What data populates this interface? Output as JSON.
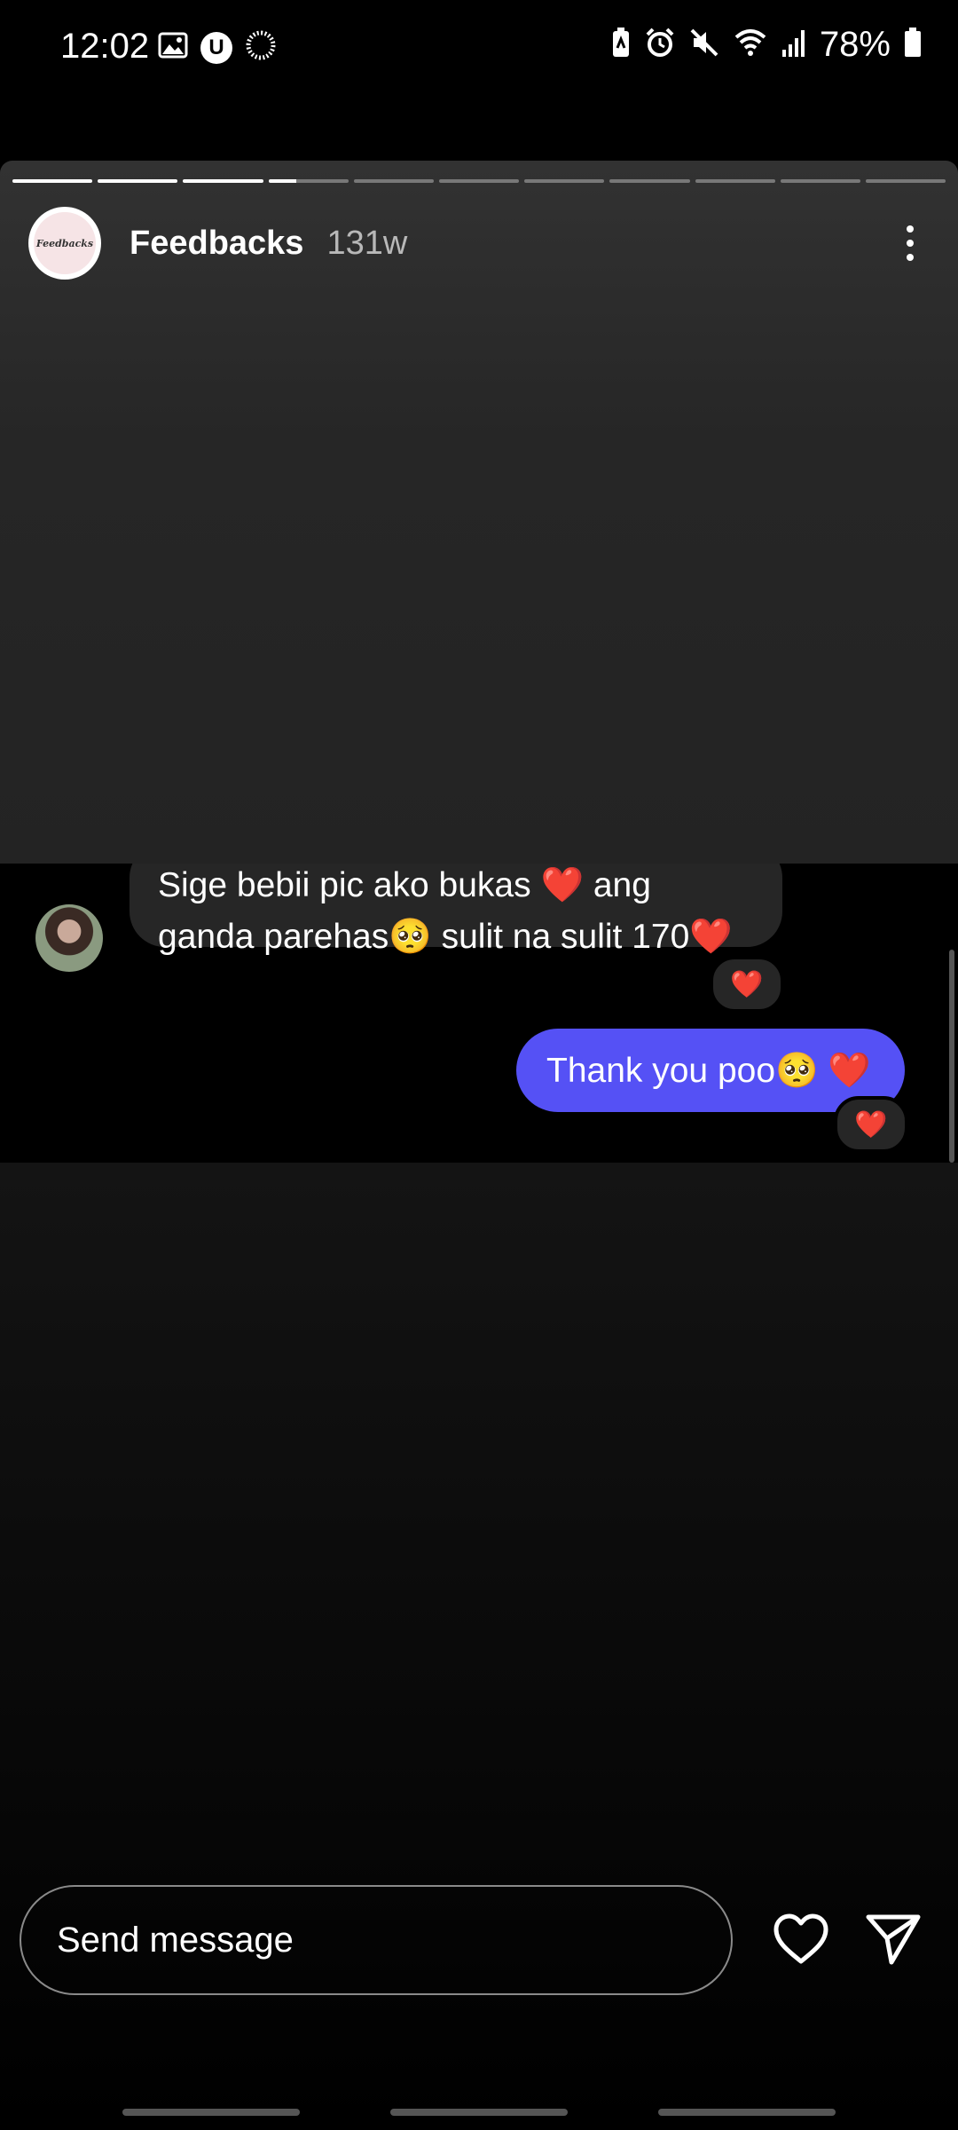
{
  "status_bar": {
    "time": "12:02",
    "battery_text": "78%",
    "left_icons": [
      "image-icon",
      "u-badge-icon",
      "loading-circle-icon"
    ],
    "right_icons": [
      "battery-saver-icon",
      "alarm-icon",
      "mute-icon",
      "wifi-icon",
      "signal-icon",
      "battery-icon"
    ],
    "u_badge": "U"
  },
  "story": {
    "username": "Feedbacks",
    "time_ago": "131w",
    "avatar_text": "Feedbacks",
    "segments_total": 11,
    "segments_completed": 3,
    "current_segment_progress": 0.35
  },
  "chat": {
    "incoming": {
      "line1": "Sige bebii pic ako bukas ❤️ ang",
      "line2": "ganda parehas🥺 sulit na sulit 170❤️",
      "reaction": "❤️"
    },
    "outgoing": {
      "text": "Thank you poo🥺 ❤️",
      "reaction": "❤️"
    }
  },
  "composer": {
    "placeholder": "Send message"
  },
  "colors": {
    "outgoing_bubble": "#5551f5",
    "incoming_bubble": "#262626",
    "heart": "#ff2c40"
  }
}
